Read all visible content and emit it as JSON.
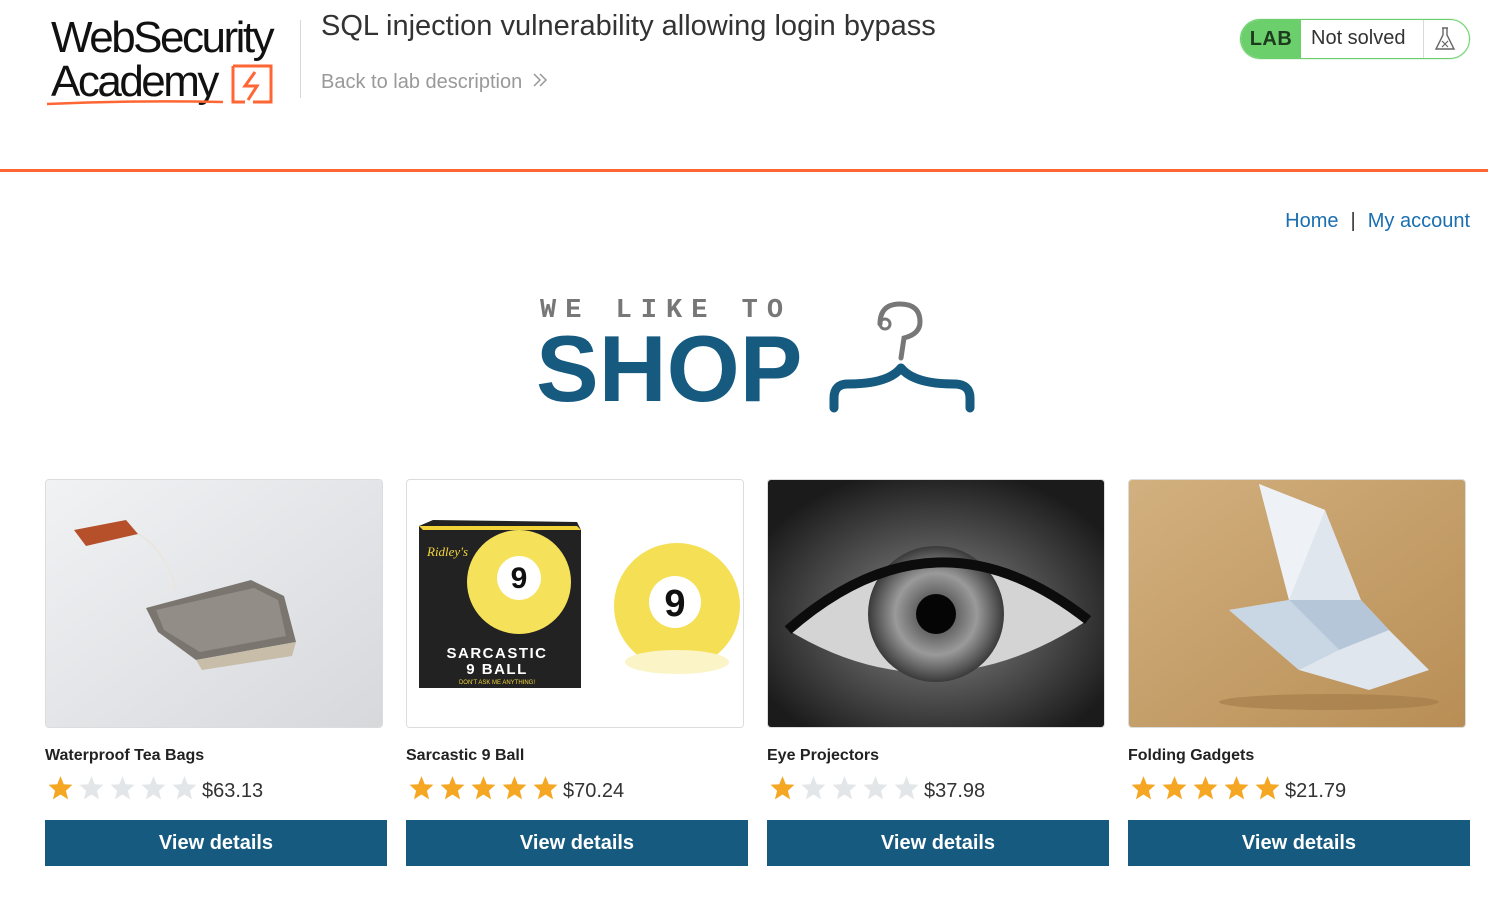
{
  "lab_header": {
    "logo_line1": "WebSecurity",
    "logo_line2": "Academy",
    "title": "SQL injection vulnerability allowing login bypass",
    "back_link": "Back to lab description",
    "lab_badge": "LAB",
    "lab_status": "Not solved",
    "colors": {
      "accent": "#ff6633",
      "status_green": "#6bcf6b"
    }
  },
  "nav": {
    "home": "Home",
    "separator": "|",
    "account": "My account"
  },
  "hero": {
    "tagline": "WE LIKE TO",
    "brand": "SHOP",
    "brand_color": "#165a80"
  },
  "products": [
    {
      "name": "Waterproof Tea Bags",
      "rating": 1,
      "price": "$63.13",
      "button": "View details",
      "image": "tea-bag-photo"
    },
    {
      "name": "Sarcastic 9 Ball",
      "rating": 5,
      "price": "$70.24",
      "button": "View details",
      "image": "nine-ball-photo"
    },
    {
      "name": "Eye Projectors",
      "rating": 1,
      "price": "$37.98",
      "button": "View details",
      "image": "eye-photo"
    },
    {
      "name": "Folding Gadgets",
      "rating": 5,
      "price": "$21.79",
      "button": "View details",
      "image": "origami-bird-photo"
    }
  ],
  "nine_ball_box": {
    "brand": "Ridley's",
    "line1": "SARCASTIC",
    "line2": "9 BALL",
    "tagline": "DON'T ASK ME ANYTHING!",
    "ball_number": "9"
  }
}
